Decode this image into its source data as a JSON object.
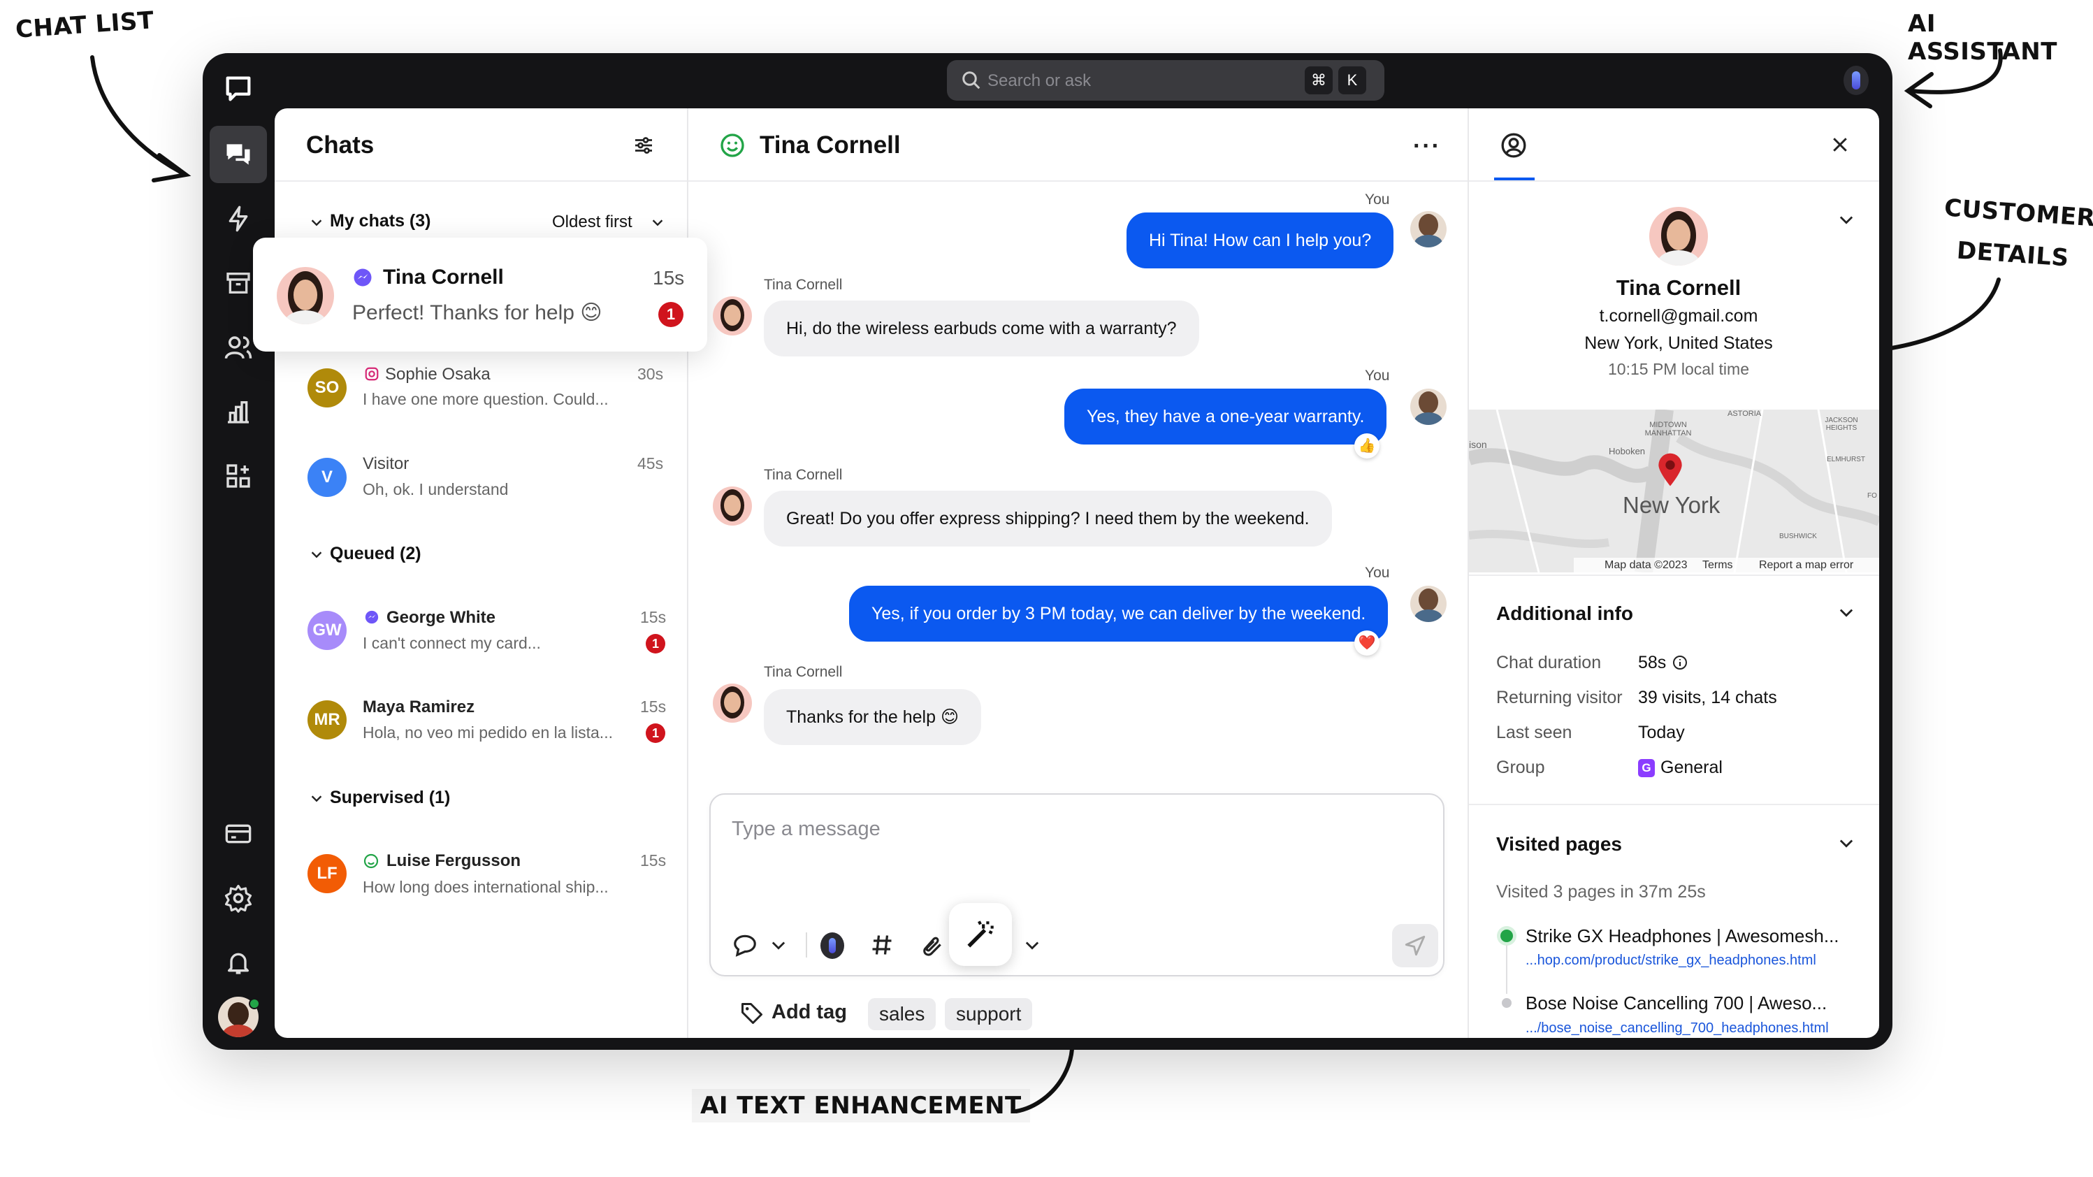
{
  "annotations": {
    "chat_list": "CHAT LIST",
    "ai_assistant": "AI ASSISTANT",
    "customer_details_line1": "CUSTOMER",
    "customer_details_line2": "DETAILS",
    "ai_text_enhancement": "AI TEXT ENHANCEMENT"
  },
  "topbar": {
    "search_placeholder": "Search or ask",
    "kbd1": "⌘",
    "kbd2": "K"
  },
  "chats": {
    "title": "Chats",
    "my_chats": "My chats (3)",
    "sort": "Oldest first",
    "queued": "Queued (2)",
    "supervised": "Supervised (1)",
    "highlight": {
      "name": "Tina Cornell",
      "time": "15s",
      "message": "Perfect! Thanks for help 😊",
      "badge": "1"
    },
    "items": [
      {
        "initials": "SO",
        "name": "Sophie Osaka",
        "time": "30s",
        "message": "I have one more question. Could...",
        "color": "#b08a0a"
      },
      {
        "initials": "V",
        "name": "Visitor",
        "time": "45s",
        "message": "Oh, ok. I understand",
        "color": "#3b82f6"
      },
      {
        "initials": "GW",
        "name": "George White",
        "time": "15s",
        "message": "I can't connect my card...",
        "badge": "1",
        "color": "#a78bfa"
      },
      {
        "initials": "MR",
        "name": "Maya Ramirez",
        "time": "15s",
        "message": "Hola, no veo mi pedido en la lista...",
        "badge": "1",
        "color": "#b08a0a"
      },
      {
        "initials": "LF",
        "name": "Luise  Fergusson",
        "time": "15s",
        "message": "How long does international ship...",
        "color": "#f25c05"
      }
    ]
  },
  "conversation": {
    "title": "Tina Cornell",
    "you": "You",
    "tina": "Tina Cornell",
    "m1": "Hi Tina! How can I help you?",
    "m2": "Hi, do the wireless earbuds come with a warranty?",
    "m3": "Yes, they have a one-year warranty.",
    "m4": "Great! Do you offer express shipping? I need them by the weekend.",
    "m5": "Yes, if you order by 3 PM today, we can deliver by the weekend.",
    "m6": "Thanks for the help 😊",
    "r1": "👍",
    "r2": "❤️",
    "composer_placeholder": "Type a message",
    "add_tag": "Add tag",
    "tags": [
      "sales",
      "support"
    ]
  },
  "customer": {
    "name": "Tina Cornell",
    "email": "t.cornell@gmail.com",
    "location": "New York, United States",
    "local_time": "10:15 PM local time",
    "map": {
      "city": "New York",
      "data": "Map data ©2023",
      "terms": "Terms",
      "report": "Report a map error",
      "l1": "MIDTOWN MANHATTAN",
      "l2": "Hoboken",
      "l3": "ASTORIA",
      "l4": "JACKSON HEIGHTS",
      "l5": "ELMHURST",
      "l6": "BUSHWICK",
      "l7": "ison",
      "l8": "FO"
    },
    "additional_title": "Additional info",
    "info": [
      {
        "k": "Chat duration",
        "v": "58s"
      },
      {
        "k": "Returning visitor",
        "v": "39 visits, 14 chats"
      },
      {
        "k": "Last seen",
        "v": "Today"
      },
      {
        "k": "Group",
        "v": "General",
        "badge": "G"
      }
    ],
    "visited_title": "Visited pages",
    "visited_summary": "Visited 3 pages in 37m 25s",
    "pages": [
      {
        "title": "Strike GX Headphones | Awesomesh...",
        "url": "...hop.com/product/strike_gx_headphones.html"
      },
      {
        "title": "Bose Noise Cancelling 700 | Aweso...",
        "url": ".../bose_noise_cancelling_700_headphones.html"
      }
    ]
  },
  "colors": {
    "accent": "#0b59f0",
    "badge": "#d0141d",
    "online": "#22a447"
  }
}
